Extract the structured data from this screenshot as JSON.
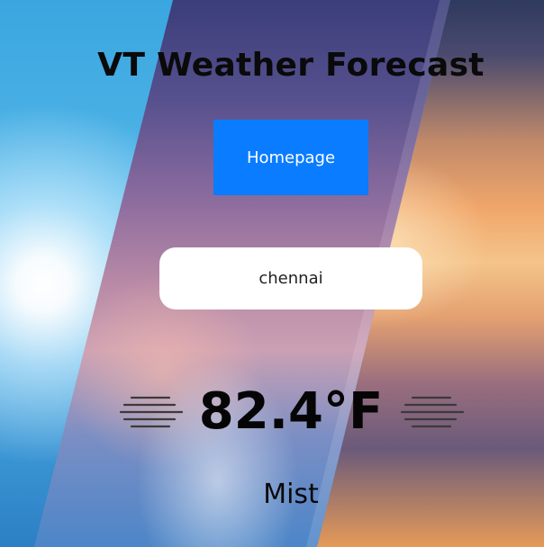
{
  "app": {
    "title": "VT Weather Forecast"
  },
  "nav": {
    "home_label": "Homepage"
  },
  "search": {
    "value": "chennai"
  },
  "weather": {
    "temperature": "82.4°F",
    "description": "Mist",
    "icon": "mist-icon"
  },
  "colors": {
    "button": "#0a7cff",
    "text": "#0a0a0a"
  }
}
